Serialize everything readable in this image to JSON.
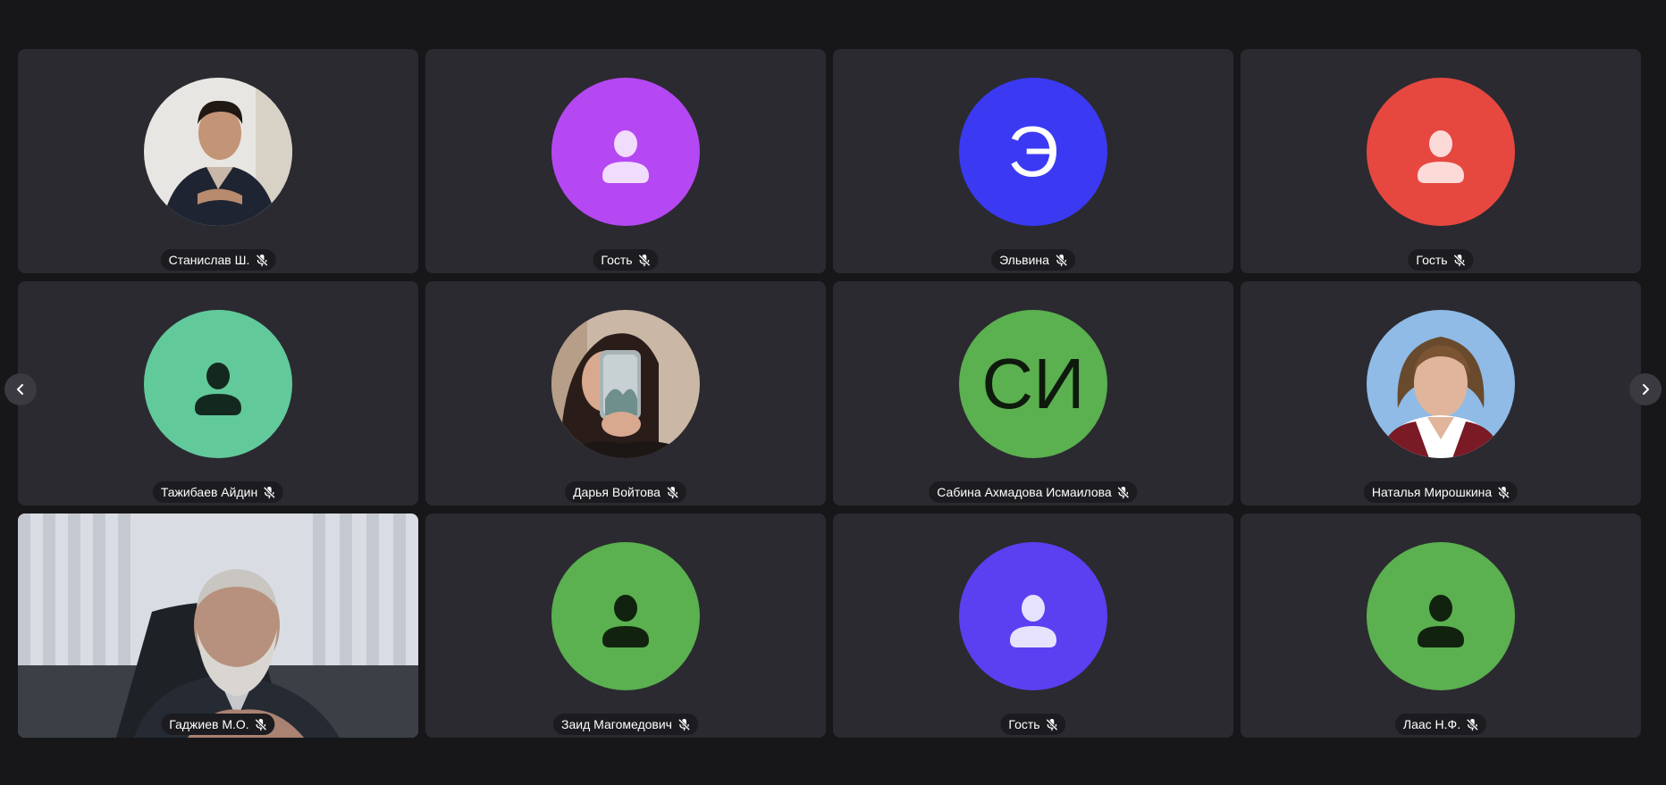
{
  "participants": [
    {
      "name": "Станислав Ш.",
      "avatar_type": "photo",
      "photo": "man-dark-sweater",
      "muted": true
    },
    {
      "name": "Гость",
      "avatar_type": "person-icon",
      "color": "#b548f2",
      "icon_color": "#f1dcfd",
      "muted": true
    },
    {
      "name": "Эльвина",
      "avatar_type": "initials",
      "initials": "Э",
      "color": "#3b3af2",
      "text_color": "#ffffff",
      "muted": true
    },
    {
      "name": "Гость",
      "avatar_type": "person-icon",
      "color": "#e64840",
      "icon_color": "#fbdad8",
      "muted": true
    },
    {
      "name": "Тажибаев Айдин",
      "avatar_type": "person-icon",
      "color": "#62c99b",
      "icon_color": "#13291f",
      "muted": true
    },
    {
      "name": "Дарья Войтова",
      "avatar_type": "photo",
      "photo": "girl-mirror-selfie",
      "muted": true
    },
    {
      "name": "Сабина Ахмадова Исмаилова",
      "avatar_type": "initials",
      "initials": "СИ",
      "color": "#5bb050",
      "text_color": "#0e1a0c",
      "muted": true
    },
    {
      "name": "Наталья Мирошкина",
      "avatar_type": "photo",
      "photo": "woman-portrait",
      "muted": true
    },
    {
      "name": "Гаджиев М.О.",
      "avatar_type": "video",
      "photo": "elderly-man-video",
      "muted": true
    },
    {
      "name": "Заид Магомедович",
      "avatar_type": "person-icon",
      "color": "#5bb050",
      "icon_color": "#11230f",
      "muted": true
    },
    {
      "name": "Гость",
      "avatar_type": "person-icon",
      "color": "#5a40f0",
      "icon_color": "#e6e2fd",
      "muted": true
    },
    {
      "name": "Лаас Н.Ф.",
      "avatar_type": "person-icon",
      "color": "#5bb050",
      "icon_color": "#11230f",
      "muted": true
    }
  ],
  "navigation": {
    "prev_icon": "chevron-left-icon",
    "next_icon": "chevron-right-icon"
  }
}
